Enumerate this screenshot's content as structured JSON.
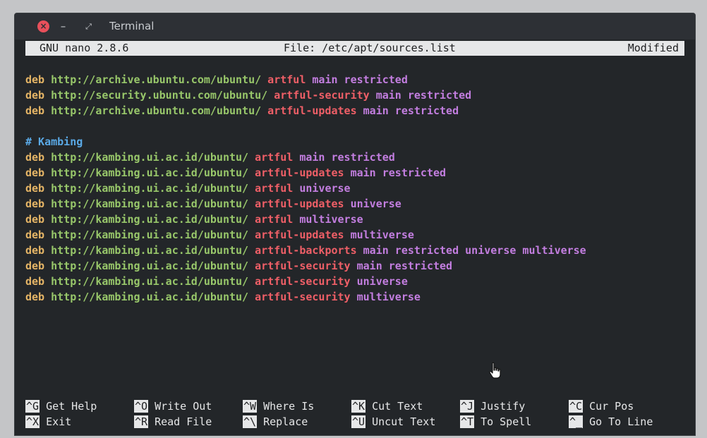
{
  "window": {
    "title": "Terminal"
  },
  "nano": {
    "version": "GNU nano 2.8.6",
    "file": "File: /etc/apt/sources.list",
    "status": "Modified"
  },
  "editor": {
    "lines": [
      [
        {
          "t": "deb ",
          "c": "deb"
        },
        {
          "t": "http://archive.ubuntu.com/ubuntu/ ",
          "c": "url"
        },
        {
          "t": "artful ",
          "c": "dist"
        },
        {
          "t": "main restricted",
          "c": "comp"
        }
      ],
      [
        {
          "t": "deb ",
          "c": "deb"
        },
        {
          "t": "http://security.ubuntu.com/ubuntu/ ",
          "c": "url"
        },
        {
          "t": "artful-security ",
          "c": "dist"
        },
        {
          "t": "main restricted",
          "c": "comp"
        }
      ],
      [
        {
          "t": "deb ",
          "c": "deb"
        },
        {
          "t": "http://archive.ubuntu.com/ubuntu/ ",
          "c": "url"
        },
        {
          "t": "artful-updates ",
          "c": "dist"
        },
        {
          "t": "main restricted",
          "c": "comp"
        }
      ],
      [],
      [
        {
          "t": "# Kambing",
          "c": "comment"
        }
      ],
      [
        {
          "t": "deb ",
          "c": "deb"
        },
        {
          "t": "http://kambing.ui.ac.id/ubuntu/ ",
          "c": "url"
        },
        {
          "t": "artful ",
          "c": "dist"
        },
        {
          "t": "main restricted",
          "c": "comp"
        }
      ],
      [
        {
          "t": "deb ",
          "c": "deb"
        },
        {
          "t": "http://kambing.ui.ac.id/ubuntu/ ",
          "c": "url"
        },
        {
          "t": "artful-updates ",
          "c": "dist"
        },
        {
          "t": "main restricted",
          "c": "comp"
        }
      ],
      [
        {
          "t": "deb ",
          "c": "deb"
        },
        {
          "t": "http://kambing.ui.ac.id/ubuntu/ ",
          "c": "url"
        },
        {
          "t": "artful ",
          "c": "dist"
        },
        {
          "t": "universe",
          "c": "comp"
        }
      ],
      [
        {
          "t": "deb ",
          "c": "deb"
        },
        {
          "t": "http://kambing.ui.ac.id/ubuntu/ ",
          "c": "url"
        },
        {
          "t": "artful-updates ",
          "c": "dist"
        },
        {
          "t": "universe",
          "c": "comp"
        }
      ],
      [
        {
          "t": "deb ",
          "c": "deb"
        },
        {
          "t": "http://kambing.ui.ac.id/ubuntu/ ",
          "c": "url"
        },
        {
          "t": "artful ",
          "c": "dist"
        },
        {
          "t": "multiverse",
          "c": "comp"
        }
      ],
      [
        {
          "t": "deb ",
          "c": "deb"
        },
        {
          "t": "http://kambing.ui.ac.id/ubuntu/ ",
          "c": "url"
        },
        {
          "t": "artful-updates ",
          "c": "dist"
        },
        {
          "t": "multiverse",
          "c": "comp"
        }
      ],
      [
        {
          "t": "deb ",
          "c": "deb"
        },
        {
          "t": "http://kambing.ui.ac.id/ubuntu/ ",
          "c": "url"
        },
        {
          "t": "artful-backports ",
          "c": "dist"
        },
        {
          "t": "main restricted universe multiverse",
          "c": "comp"
        }
      ],
      [
        {
          "t": "deb ",
          "c": "deb"
        },
        {
          "t": "http://kambing.ui.ac.id/ubuntu/ ",
          "c": "url"
        },
        {
          "t": "artful-security ",
          "c": "dist"
        },
        {
          "t": "main restricted",
          "c": "comp"
        }
      ],
      [
        {
          "t": "deb ",
          "c": "deb"
        },
        {
          "t": "http://kambing.ui.ac.id/ubuntu/ ",
          "c": "url"
        },
        {
          "t": "artful-security ",
          "c": "dist"
        },
        {
          "t": "universe",
          "c": "comp"
        }
      ],
      [
        {
          "t": "deb ",
          "c": "deb"
        },
        {
          "t": "http://kambing.ui.ac.id/ubuntu/ ",
          "c": "url"
        },
        {
          "t": "artful-security ",
          "c": "dist"
        },
        {
          "t": "multiverse",
          "c": "comp"
        }
      ]
    ]
  },
  "shortcuts": {
    "row1": [
      {
        "key": "^G",
        "label": "Get Help"
      },
      {
        "key": "^O",
        "label": "Write Out"
      },
      {
        "key": "^W",
        "label": "Where Is"
      },
      {
        "key": "^K",
        "label": "Cut Text"
      },
      {
        "key": "^J",
        "label": "Justify"
      },
      {
        "key": "^C",
        "label": "Cur Pos"
      }
    ],
    "row2": [
      {
        "key": "^X",
        "label": "Exit"
      },
      {
        "key": "^R",
        "label": "Read File"
      },
      {
        "key": "^\\",
        "label": "Replace"
      },
      {
        "key": "^U",
        "label": "Uncut Text"
      },
      {
        "key": "^T",
        "label": "To Spell"
      },
      {
        "key": "^_",
        "label": "Go To Line"
      }
    ]
  },
  "colors": {
    "deb": "#e5b566",
    "url": "#98c76a",
    "dist": "#ef5f67",
    "comp": "#c37ee0",
    "comment": "#5aa9e6"
  },
  "icons": {
    "close": "close-icon",
    "minimize": "minimize-icon",
    "maximize": "maximize-icon",
    "pointer": "hand-pointer-icon"
  }
}
